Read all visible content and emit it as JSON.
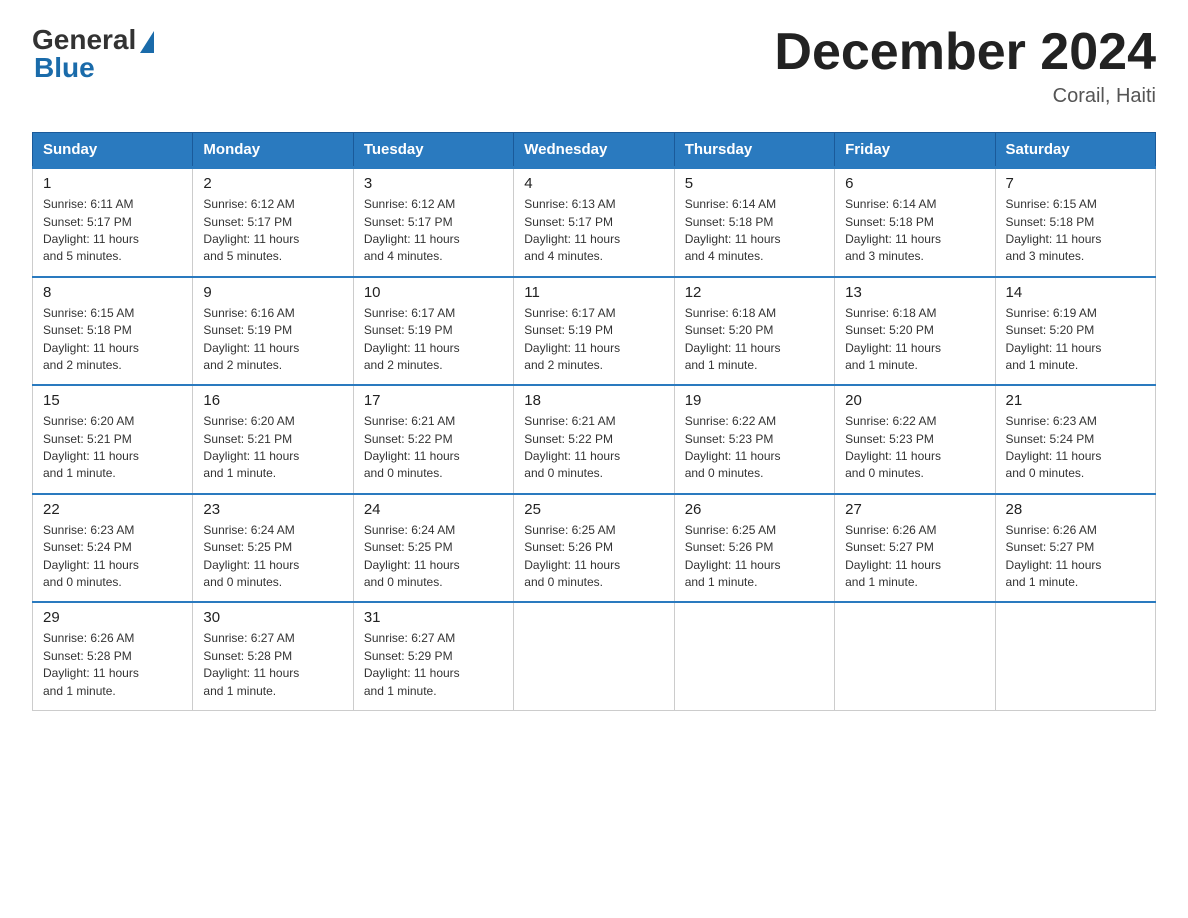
{
  "header": {
    "logo_general": "General",
    "logo_blue": "Blue",
    "title": "December 2024",
    "location": "Corail, Haiti"
  },
  "days_of_week": [
    "Sunday",
    "Monday",
    "Tuesday",
    "Wednesday",
    "Thursday",
    "Friday",
    "Saturday"
  ],
  "weeks": [
    [
      {
        "day": "1",
        "sunrise": "6:11 AM",
        "sunset": "5:17 PM",
        "daylight": "11 hours and 5 minutes."
      },
      {
        "day": "2",
        "sunrise": "6:12 AM",
        "sunset": "5:17 PM",
        "daylight": "11 hours and 5 minutes."
      },
      {
        "day": "3",
        "sunrise": "6:12 AM",
        "sunset": "5:17 PM",
        "daylight": "11 hours and 4 minutes."
      },
      {
        "day": "4",
        "sunrise": "6:13 AM",
        "sunset": "5:17 PM",
        "daylight": "11 hours and 4 minutes."
      },
      {
        "day": "5",
        "sunrise": "6:14 AM",
        "sunset": "5:18 PM",
        "daylight": "11 hours and 4 minutes."
      },
      {
        "day": "6",
        "sunrise": "6:14 AM",
        "sunset": "5:18 PM",
        "daylight": "11 hours and 3 minutes."
      },
      {
        "day": "7",
        "sunrise": "6:15 AM",
        "sunset": "5:18 PM",
        "daylight": "11 hours and 3 minutes."
      }
    ],
    [
      {
        "day": "8",
        "sunrise": "6:15 AM",
        "sunset": "5:18 PM",
        "daylight": "11 hours and 2 minutes."
      },
      {
        "day": "9",
        "sunrise": "6:16 AM",
        "sunset": "5:19 PM",
        "daylight": "11 hours and 2 minutes."
      },
      {
        "day": "10",
        "sunrise": "6:17 AM",
        "sunset": "5:19 PM",
        "daylight": "11 hours and 2 minutes."
      },
      {
        "day": "11",
        "sunrise": "6:17 AM",
        "sunset": "5:19 PM",
        "daylight": "11 hours and 2 minutes."
      },
      {
        "day": "12",
        "sunrise": "6:18 AM",
        "sunset": "5:20 PM",
        "daylight": "11 hours and 1 minute."
      },
      {
        "day": "13",
        "sunrise": "6:18 AM",
        "sunset": "5:20 PM",
        "daylight": "11 hours and 1 minute."
      },
      {
        "day": "14",
        "sunrise": "6:19 AM",
        "sunset": "5:20 PM",
        "daylight": "11 hours and 1 minute."
      }
    ],
    [
      {
        "day": "15",
        "sunrise": "6:20 AM",
        "sunset": "5:21 PM",
        "daylight": "11 hours and 1 minute."
      },
      {
        "day": "16",
        "sunrise": "6:20 AM",
        "sunset": "5:21 PM",
        "daylight": "11 hours and 1 minute."
      },
      {
        "day": "17",
        "sunrise": "6:21 AM",
        "sunset": "5:22 PM",
        "daylight": "11 hours and 0 minutes."
      },
      {
        "day": "18",
        "sunrise": "6:21 AM",
        "sunset": "5:22 PM",
        "daylight": "11 hours and 0 minutes."
      },
      {
        "day": "19",
        "sunrise": "6:22 AM",
        "sunset": "5:23 PM",
        "daylight": "11 hours and 0 minutes."
      },
      {
        "day": "20",
        "sunrise": "6:22 AM",
        "sunset": "5:23 PM",
        "daylight": "11 hours and 0 minutes."
      },
      {
        "day": "21",
        "sunrise": "6:23 AM",
        "sunset": "5:24 PM",
        "daylight": "11 hours and 0 minutes."
      }
    ],
    [
      {
        "day": "22",
        "sunrise": "6:23 AM",
        "sunset": "5:24 PM",
        "daylight": "11 hours and 0 minutes."
      },
      {
        "day": "23",
        "sunrise": "6:24 AM",
        "sunset": "5:25 PM",
        "daylight": "11 hours and 0 minutes."
      },
      {
        "day": "24",
        "sunrise": "6:24 AM",
        "sunset": "5:25 PM",
        "daylight": "11 hours and 0 minutes."
      },
      {
        "day": "25",
        "sunrise": "6:25 AM",
        "sunset": "5:26 PM",
        "daylight": "11 hours and 0 minutes."
      },
      {
        "day": "26",
        "sunrise": "6:25 AM",
        "sunset": "5:26 PM",
        "daylight": "11 hours and 1 minute."
      },
      {
        "day": "27",
        "sunrise": "6:26 AM",
        "sunset": "5:27 PM",
        "daylight": "11 hours and 1 minute."
      },
      {
        "day": "28",
        "sunrise": "6:26 AM",
        "sunset": "5:27 PM",
        "daylight": "11 hours and 1 minute."
      }
    ],
    [
      {
        "day": "29",
        "sunrise": "6:26 AM",
        "sunset": "5:28 PM",
        "daylight": "11 hours and 1 minute."
      },
      {
        "day": "30",
        "sunrise": "6:27 AM",
        "sunset": "5:28 PM",
        "daylight": "11 hours and 1 minute."
      },
      {
        "day": "31",
        "sunrise": "6:27 AM",
        "sunset": "5:29 PM",
        "daylight": "11 hours and 1 minute."
      },
      null,
      null,
      null,
      null
    ]
  ],
  "labels": {
    "sunrise": "Sunrise:",
    "sunset": "Sunset:",
    "daylight": "Daylight:"
  }
}
